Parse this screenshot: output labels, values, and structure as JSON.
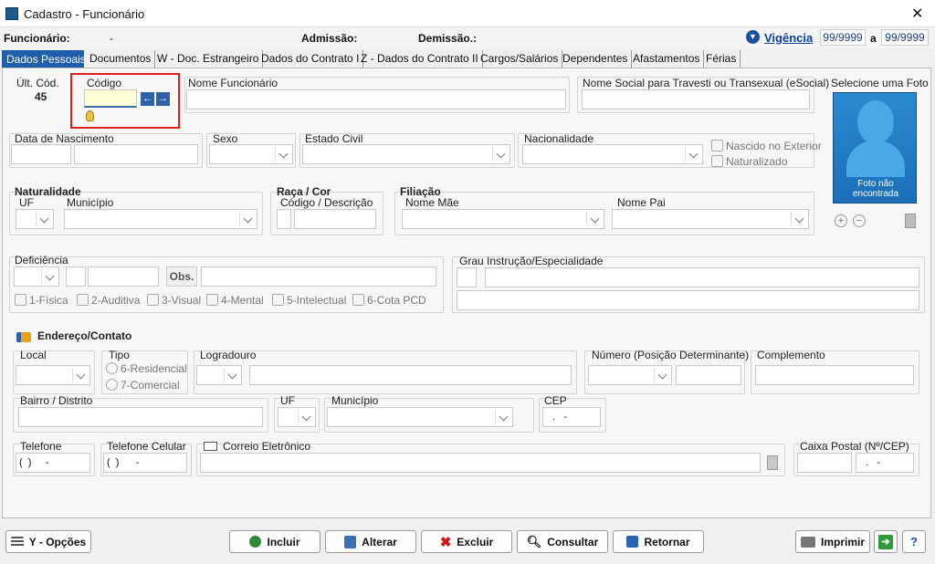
{
  "window": {
    "title": "Cadastro - Funcionário",
    "close": "✕"
  },
  "header": {
    "funcionario_label": "Funcionário:",
    "funcionario_value": "-",
    "admissao_label": "Admissão:",
    "demissao_label": "Demissão.:",
    "vigencia_label": "Vigência",
    "vigencia_from": "99/9999",
    "vigencia_sep": "a",
    "vigencia_to": "99/9999"
  },
  "tabs": [
    "Dados Pessoais",
    "Documentos",
    "W - Doc. Estrangeiro",
    "Dados do Contrato I",
    "Z - Dados do Contrato II",
    "Cargos/Salários",
    "Dependentes",
    "Afastamentos",
    "Férias"
  ],
  "pessoais": {
    "ult_cod_label": "Últ. Cód.",
    "ult_cod_value": "45",
    "codigo_label": "Código",
    "nome_label": "Nome Funcionário",
    "nome_social_label": "Nome Social para Travesti ou Transexual (eSocial)",
    "foto_label": "Selecione uma Foto",
    "foto_text": "Foto não encontrada",
    "nascimento_label": "Data de Nascimento",
    "sexo_label": "Sexo",
    "estado_civil_label": "Estado Civil",
    "nacionalidade_label": "Nacionalidade",
    "nascido_exterior": "Nascido no Exterior",
    "naturalizado": "Naturalizado",
    "naturalidade_label": "Naturalidade",
    "uf_label": "UF",
    "municipio_label": "Município",
    "raca_label": "Raça / Cor",
    "codigo_desc_label": "Código / Descrição",
    "filiacao_label": "Filiação",
    "mae_label": "Nome Mãe",
    "pai_label": "Nome Pai",
    "deficiencia_label": "Deficiência",
    "obs_label": "Obs.",
    "deficiencias": [
      "1-Física",
      "2-Auditiva",
      "3-Visual",
      "4-Mental",
      "5-Intelectual",
      "6-Cota PCD"
    ],
    "grau_label": "Grau Instrução/Especialidade"
  },
  "endereco": {
    "title": "Endereço/Contato",
    "local_label": "Local",
    "tipo_label": "Tipo",
    "residencial": "6-Residencial",
    "comercial": "7-Comercial",
    "logradouro_label": "Logradouro",
    "numero_label": "Número (Posição Determinante)",
    "complemento_label": "Complemento",
    "bairro_label": "Bairro / Distrito",
    "uf_label": "UF",
    "municipio_label": "Município",
    "cep_label": "CEP",
    "cep_mask": "  .   -",
    "telefone_label": "Telefone",
    "telefone_mask": "(  )     -",
    "celular_label": "Telefone Celular",
    "celular_mask": "(  )      -",
    "email_label": "Correio Eletrônico",
    "caixa_postal_label": "Caixa Postal (Nº/CEP)",
    "caixa_postal_mask": "  .   -"
  },
  "buttons": {
    "opcoes": "Y - Opções",
    "incluir": "Incluir",
    "alterar": "Alterar",
    "excluir": "Excluir",
    "consultar": "Consultar",
    "retornar": "Retornar",
    "imprimir": "Imprimir",
    "help": "?"
  }
}
